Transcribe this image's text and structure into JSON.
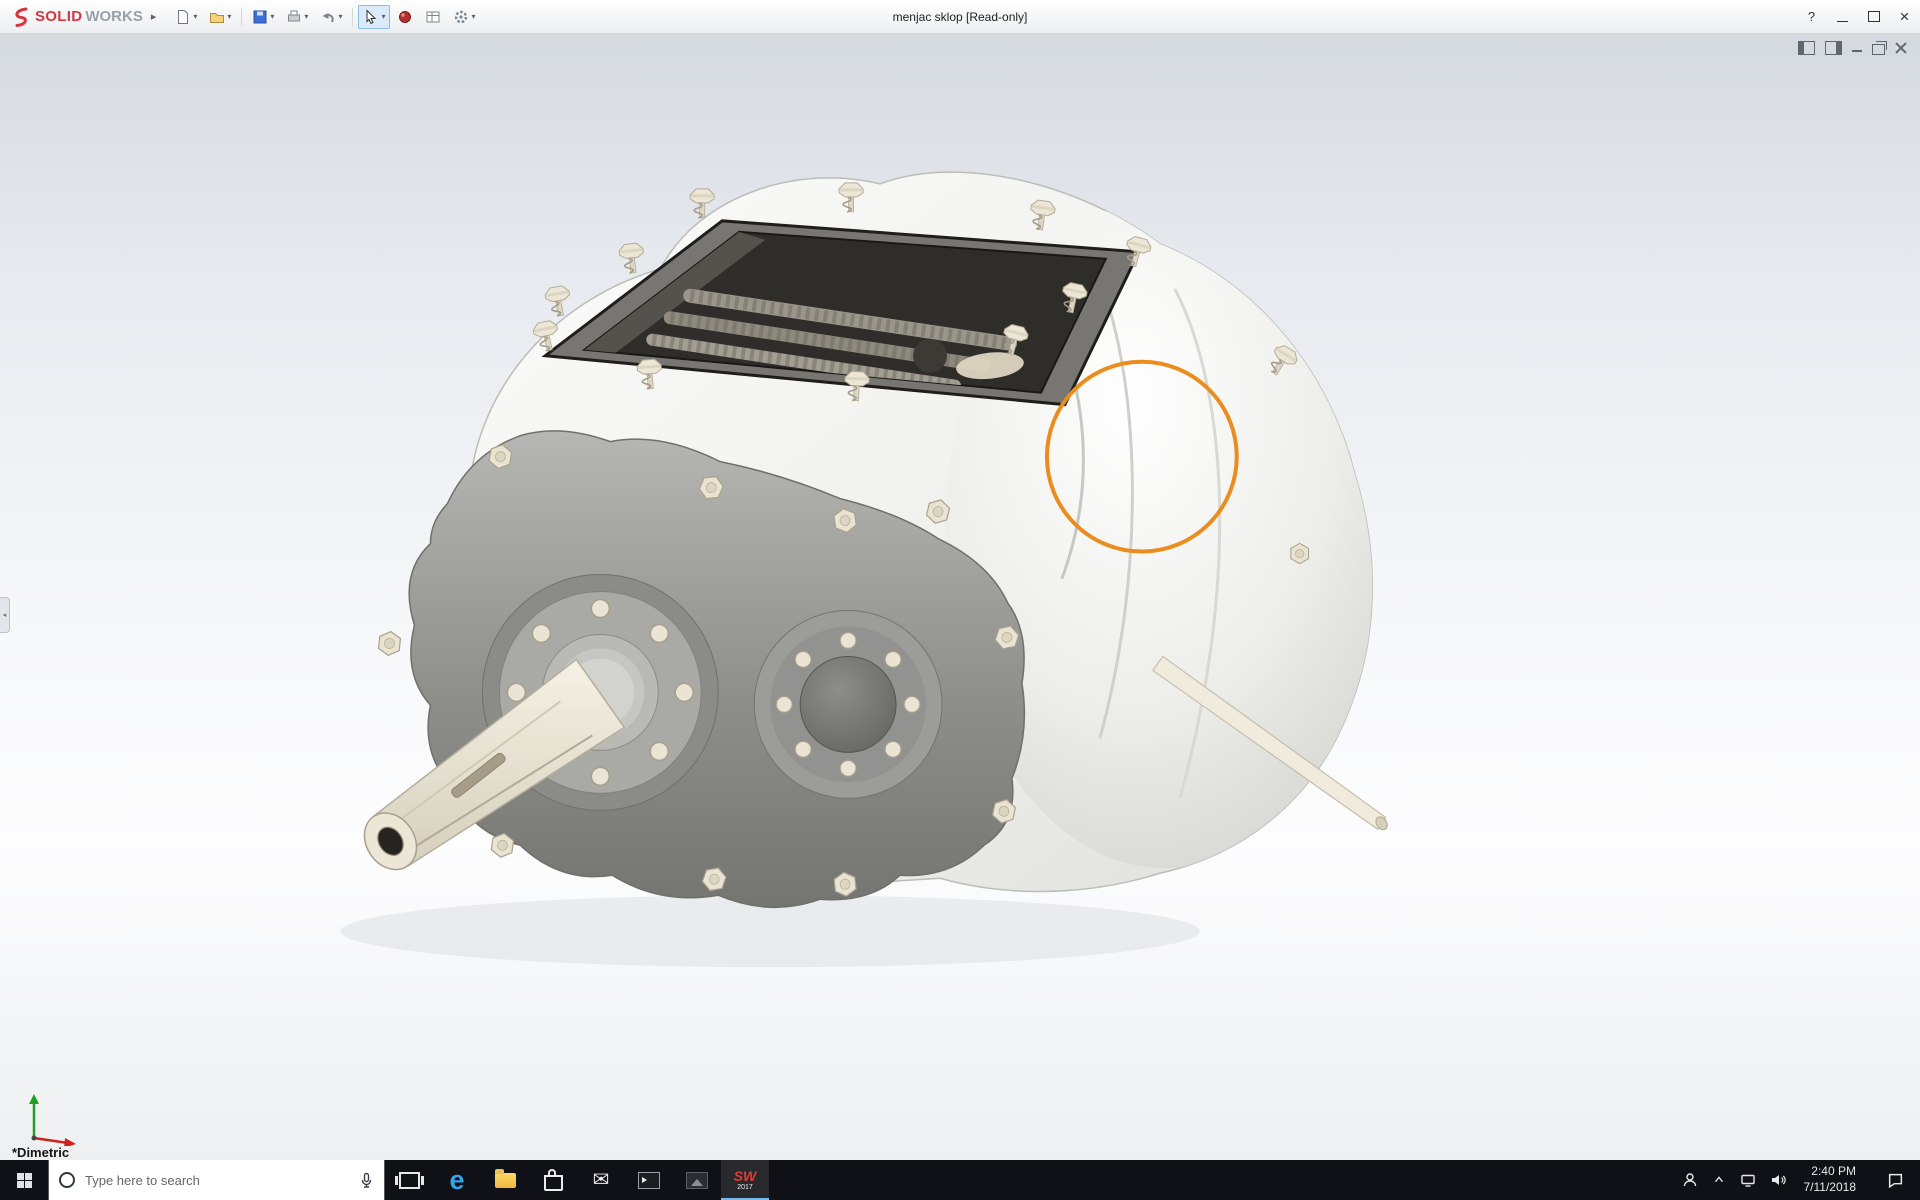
{
  "titlebar": {
    "brand": {
      "bold": "SOLID",
      "light": "WORKS"
    },
    "expand_arrow": "▸",
    "document_title": "menjac sklop [Read-only]",
    "toolbar_items": [
      "new-document",
      "open",
      "save",
      "print",
      "undo",
      "select",
      "appearance",
      "design-table",
      "options"
    ],
    "window_controls": {
      "help": "?",
      "close": "×"
    }
  },
  "viewport": {
    "view_label": "*Dimetric",
    "highlight_circle_color": "#EB8C1E",
    "doc_window_controls": [
      "pane-left",
      "pane-right",
      "minimize",
      "restore",
      "close"
    ],
    "triad": {
      "x_color": "#d02020",
      "y_color": "#1fa01f"
    }
  },
  "taskbar": {
    "search_placeholder": "Type here to search",
    "apps": [
      "task-view",
      "edge",
      "file-explorer",
      "store",
      "mail",
      "command-prompt",
      "photos",
      "solidworks"
    ],
    "edge_glyph": "e",
    "solidworks": {
      "label": "SW",
      "year": "2017"
    },
    "tray": {
      "time": "2:40 PM",
      "date": "7/11/2018"
    }
  }
}
